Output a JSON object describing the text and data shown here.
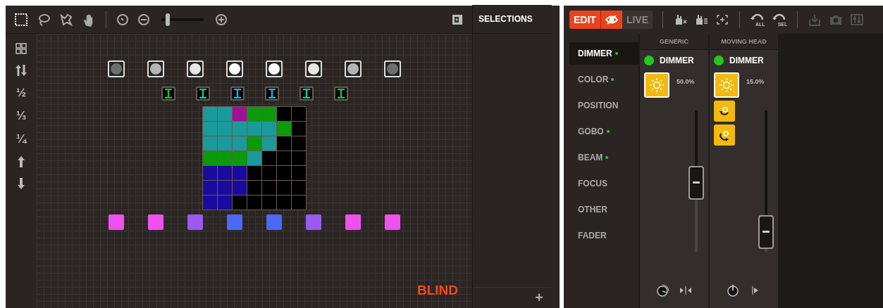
{
  "canvas_toolbar": {
    "tools": [
      {
        "kind": "marquee",
        "selected": true
      },
      {
        "kind": "lasso",
        "selected": false
      },
      {
        "kind": "path",
        "selected": false
      },
      {
        "kind": "hand",
        "selected": false
      }
    ],
    "zoom": {
      "level": 0.15
    },
    "panel_toggle": true
  },
  "sidebar": [
    {
      "kind": "grid"
    },
    {
      "kind": "swap"
    },
    {
      "kind": "text",
      "label": "½"
    },
    {
      "kind": "text",
      "label": "⅓"
    },
    {
      "kind": "text",
      "label": "¼"
    },
    {
      "kind": "up"
    },
    {
      "kind": "down"
    }
  ],
  "fixtures": {
    "dimmers": [
      {
        "color": "#6e6e6e"
      },
      {
        "color": "#b4b4b4"
      },
      {
        "color": "#e6e6e6"
      },
      {
        "color": "#ffffff"
      },
      {
        "color": "#ffffff"
      },
      {
        "color": "#e6e6e6"
      },
      {
        "color": "#b4b4b4"
      },
      {
        "color": "#6e6e6e"
      }
    ],
    "moving_heads": [
      {
        "color": "#1fc03a"
      },
      {
        "color": "#1ec09a"
      },
      {
        "color": "#1ab4e6"
      },
      {
        "color": "#1ab4e6"
      },
      {
        "color": "#1ec09a"
      },
      {
        "color": "#1fc03a"
      }
    ],
    "matrix": [
      {
        "cells": [
          {
            "color": "#1a9a9a"
          },
          {
            "color": "#1a9a9a"
          },
          {
            "color": "#a0109a"
          },
          {
            "color": "#0a9a0a"
          },
          {
            "color": "#0a9a0a"
          },
          {
            "color": "#000000"
          },
          {
            "color": "#000000"
          }
        ]
      },
      {
        "cells": [
          {
            "color": "#1a9a9a"
          },
          {
            "color": "#1a9a9a"
          },
          {
            "color": "#1a9a9a"
          },
          {
            "color": "#1a9a9a"
          },
          {
            "color": "#1a9a9a"
          },
          {
            "color": "#0a9a0a"
          },
          {
            "color": "#000000"
          }
        ]
      },
      {
        "cells": [
          {
            "color": "#1a9a9a"
          },
          {
            "color": "#1a9a9a"
          },
          {
            "color": "#1a9a9a"
          },
          {
            "color": "#0a9a0a"
          },
          {
            "color": "#1a9a9a"
          },
          {
            "color": "#000000"
          },
          {
            "color": "#000000"
          }
        ]
      },
      {
        "cells": [
          {
            "color": "#0a9a0a"
          },
          {
            "color": "#0a9a0a"
          },
          {
            "color": "#0a9a0a"
          },
          {
            "color": "#1a9a9a"
          },
          {
            "color": "#000000"
          },
          {
            "color": "#000000"
          },
          {
            "color": "#000000"
          }
        ]
      },
      {
        "cells": [
          {
            "color": "#1a0aa0"
          },
          {
            "color": "#1a0aa0"
          },
          {
            "color": "#1a0aa0"
          },
          {
            "color": "#000000"
          },
          {
            "color": "#000000"
          },
          {
            "color": "#000000"
          },
          {
            "color": "#000000"
          }
        ]
      },
      {
        "cells": [
          {
            "color": "#1a0aa0"
          },
          {
            "color": "#1a0aa0"
          },
          {
            "color": "#1a0aa0"
          },
          {
            "color": "#000000"
          },
          {
            "color": "#000000"
          },
          {
            "color": "#000000"
          },
          {
            "color": "#000000"
          }
        ]
      },
      {
        "cells": [
          {
            "color": "#1a0aa0"
          },
          {
            "color": "#1a0aa0"
          },
          {
            "color": "#000000"
          },
          {
            "color": "#000000"
          },
          {
            "color": "#000000"
          },
          {
            "color": "#000000"
          },
          {
            "color": "#000000"
          }
        ]
      }
    ],
    "pars": [
      {
        "color": "#f050f0"
      },
      {
        "color": "#f050f0"
      },
      {
        "color": "#9a5af0"
      },
      {
        "color": "#4a6af5"
      },
      {
        "color": "#4a6af5"
      },
      {
        "color": "#9a5af0"
      },
      {
        "color": "#f050f0"
      },
      {
        "color": "#f050f0"
      }
    ]
  },
  "blind_label": "BLIND",
  "selections": {
    "title": "SELECTIONS",
    "add_button": "+"
  },
  "programmer": {
    "modes": [
      {
        "kind": "text",
        "label": "EDIT",
        "selected": true
      },
      {
        "kind": "blind",
        "selected": true
      },
      {
        "kind": "text",
        "label": "LIVE",
        "selected": false
      }
    ],
    "tools": [
      {
        "kind": "knockout",
        "disabled": false
      },
      {
        "kind": "fan",
        "disabled": false
      },
      {
        "kind": "focus",
        "disabled": false
      },
      {
        "kind": "undo",
        "label": "ALL",
        "disabled": false
      },
      {
        "kind": "undo",
        "label": "SEL",
        "disabled": false
      },
      {
        "kind": "download",
        "disabled": true
      },
      {
        "kind": "camera",
        "disabled": true
      },
      {
        "kind": "presets",
        "disabled": true
      }
    ],
    "categories": [
      {
        "label": "DIMMER",
        "active": true,
        "selected": true
      },
      {
        "label": "COLOR",
        "active": true,
        "selected": false
      },
      {
        "label": "POSITION",
        "active": false,
        "selected": false
      },
      {
        "label": "GOBO",
        "active": true,
        "selected": false
      },
      {
        "label": "BEAM",
        "active": true,
        "selected": false
      },
      {
        "label": "FOCUS",
        "active": false,
        "selected": false
      },
      {
        "label": "OTHER",
        "active": false,
        "selected": false
      },
      {
        "label": "FADER",
        "active": false,
        "selected": false
      }
    ],
    "columns": [
      {
        "header": "GENERIC",
        "channel": "DIMMER",
        "on": true,
        "value": "50.0%",
        "level": 0.5,
        "footer": [
          {
            "kind": "knob"
          },
          {
            "kind": "center"
          }
        ]
      },
      {
        "header": "MOVING HEAD",
        "channel": "DIMMER",
        "on": true,
        "value": "15.0%",
        "level": 0.15,
        "extras": [
          {
            "kind": "rotate-ccw"
          },
          {
            "kind": "rotate-cw"
          }
        ],
        "footer": [
          {
            "kind": "power"
          },
          {
            "kind": "play"
          }
        ]
      }
    ]
  }
}
